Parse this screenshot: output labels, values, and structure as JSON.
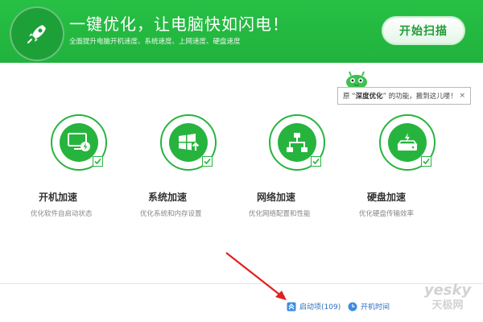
{
  "header": {
    "headline": "一键优化，让电脑快如闪电！",
    "subline": "全面提升电脑开机速度、系统速度、上网速度、硬盘速度",
    "scan_button": "开始扫描",
    "brand_color": "#21b23d"
  },
  "tooltip": {
    "prefix": "原 “",
    "bold": "深度优化",
    "suffix": "” 的功能，搬到这儿喽！",
    "close": "×"
  },
  "features": [
    {
      "title": "开机加速",
      "desc": "优化软件自启动状态",
      "icon": "monitor-bolt-icon",
      "checked": true
    },
    {
      "title": "系统加速",
      "desc": "优化系统和内存设置",
      "icon": "windows-up-icon",
      "checked": true
    },
    {
      "title": "网络加速",
      "desc": "优化网络配置和性能",
      "icon": "network-icon",
      "checked": true
    },
    {
      "title": "硬盘加速",
      "desc": "优化硬盘传输效率",
      "icon": "harddisk-bolt-icon",
      "checked": true
    }
  ],
  "footer": {
    "startup_items": "启动项(109)",
    "boot_time": "开机时间"
  },
  "watermark": {
    "line1": "yesky",
    "line2": "天极网"
  }
}
